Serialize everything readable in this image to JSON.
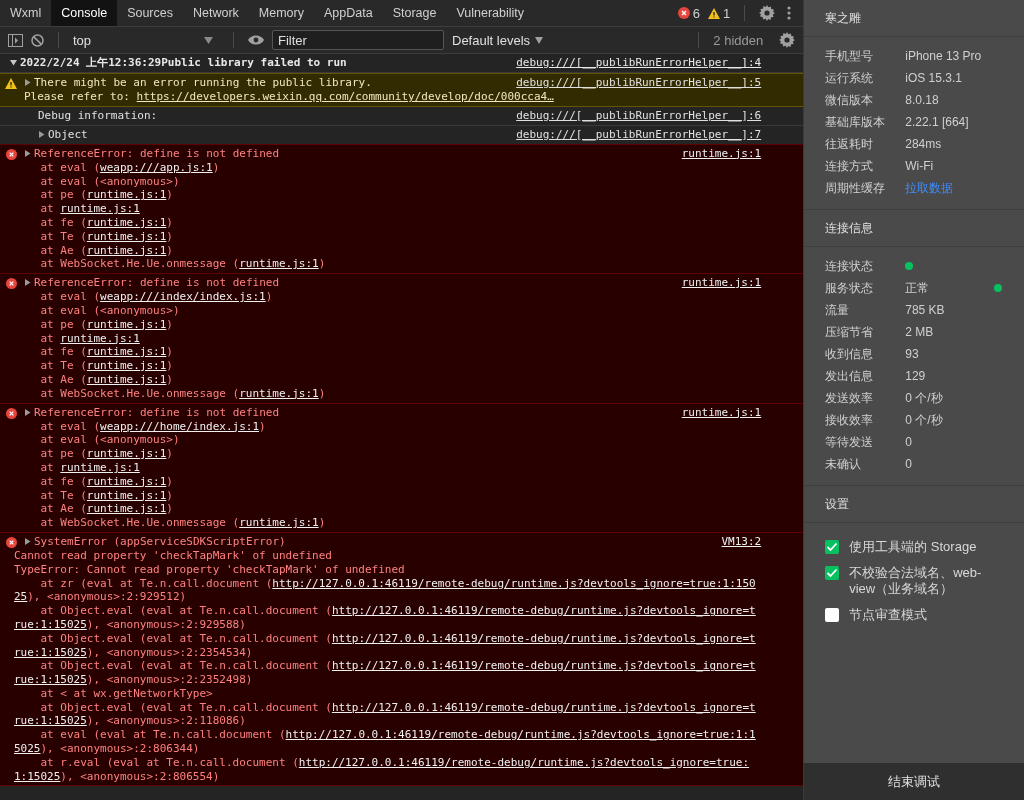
{
  "tabs": [
    {
      "label": "Wxml",
      "selected": false
    },
    {
      "label": "Console",
      "selected": true
    },
    {
      "label": "Sources",
      "selected": false
    },
    {
      "label": "Network",
      "selected": false
    },
    {
      "label": "Memory",
      "selected": false
    },
    {
      "label": "AppData",
      "selected": false
    },
    {
      "label": "Storage",
      "selected": false
    },
    {
      "label": "Vulnerability",
      "selected": false
    }
  ],
  "counts": {
    "errors": "6",
    "warnings": "1"
  },
  "toolbar": {
    "context": "top",
    "filter_placeholder": "Filter",
    "levels": "Default levels",
    "hidden": "2 hidden"
  },
  "console": [
    {
      "kind": "group",
      "expanded": true,
      "title": "2022/2/24 上午12:36:29Public library failed to run",
      "source": "debug:///[__publibRunErrorHelper__]:4"
    },
    {
      "kind": "warning",
      "expanded": false,
      "title": "There might be an error running the public library.",
      "source": "debug:///[__publibRunErrorHelper__]:5",
      "message": [
        {
          "text": "Please refer to: ",
          "link": "https://developers.weixin.qq.com/community/develop/doc/000cca4…"
        }
      ]
    },
    {
      "kind": "info",
      "title": "Debug information:",
      "source": "debug:///[__publibRunErrorHelper__]:6"
    },
    {
      "kind": "info",
      "expanded": false,
      "title": "Object",
      "source": "debug:///[__publibRunErrorHelper__]:7"
    },
    {
      "kind": "error",
      "expanded": false,
      "title": "ReferenceError: define is not defined",
      "source": "runtime.js:1",
      "stack": [
        {
          "text": "at eval (",
          "link": "weapp:///app.js:1",
          "after": ")"
        },
        {
          "text": "at eval (<anonymous>)"
        },
        {
          "text": "at pe (",
          "link": "runtime.js:1",
          "after": ")"
        },
        {
          "text": "at ",
          "link": "runtime.js:1"
        },
        {
          "text": "at fe (",
          "link": "runtime.js:1",
          "after": ")"
        },
        {
          "text": "at Te (",
          "link": "runtime.js:1",
          "after": ")"
        },
        {
          "text": "at Ae (",
          "link": "runtime.js:1",
          "after": ")"
        },
        {
          "text": "at WebSocket.He.Ue.onmessage (",
          "link": "runtime.js:1",
          "after": ")"
        }
      ]
    },
    {
      "kind": "error",
      "expanded": false,
      "title": "ReferenceError: define is not defined",
      "source": "runtime.js:1",
      "stack": [
        {
          "text": "at eval (",
          "link": "weapp:///index/index.js:1",
          "after": ")"
        },
        {
          "text": "at eval (<anonymous>)"
        },
        {
          "text": "at pe (",
          "link": "runtime.js:1",
          "after": ")"
        },
        {
          "text": "at ",
          "link": "runtime.js:1"
        },
        {
          "text": "at fe (",
          "link": "runtime.js:1",
          "after": ")"
        },
        {
          "text": "at Te (",
          "link": "runtime.js:1",
          "after": ")"
        },
        {
          "text": "at Ae (",
          "link": "runtime.js:1",
          "after": ")"
        },
        {
          "text": "at WebSocket.He.Ue.onmessage (",
          "link": "runtime.js:1",
          "after": ")"
        }
      ]
    },
    {
      "kind": "error",
      "expanded": false,
      "title": "ReferenceError: define is not defined",
      "source": "runtime.js:1",
      "stack": [
        {
          "text": "at eval (",
          "link": "weapp:///home/index.js:1",
          "after": ")"
        },
        {
          "text": "at eval (<anonymous>)"
        },
        {
          "text": "at pe (",
          "link": "runtime.js:1",
          "after": ")"
        },
        {
          "text": "at ",
          "link": "runtime.js:1"
        },
        {
          "text": "at fe (",
          "link": "runtime.js:1",
          "after": ")"
        },
        {
          "text": "at Te (",
          "link": "runtime.js:1",
          "after": ")"
        },
        {
          "text": "at Ae (",
          "link": "runtime.js:1",
          "after": ")"
        },
        {
          "text": "at WebSocket.He.Ue.onmessage (",
          "link": "runtime.js:1",
          "after": ")"
        }
      ]
    },
    {
      "kind": "error",
      "expanded": false,
      "title": "SystemError (appServiceSDKScriptError)",
      "source": "VM13:2",
      "message": [
        {
          "text": "Cannot read property 'checkTapMark' of undefined"
        },
        {
          "text": "TypeError: Cannot read property 'checkTapMark' of undefined"
        }
      ],
      "stack": [
        {
          "continued": false,
          "text": "at zr (eval at Te.n.call.document (",
          "link": "http://127.0.0.1:46119/remote-debug/runtime.js?devtools_ignore=true:1:150"
        },
        {
          "continued": true,
          "link": "25",
          "after": "), <anonymous>:2:929512)"
        },
        {
          "continued": false,
          "text": "at Object.eval (eval at Te.n.call.document (",
          "link": "http://127.0.0.1:46119/remote-debug/runtime.js?devtools_ignore=t"
        },
        {
          "continued": true,
          "link": "rue:1:15025",
          "after": "), <anonymous>:2:929588)"
        },
        {
          "continued": false,
          "text": "at Object.eval (eval at Te.n.call.document (",
          "link": "http://127.0.0.1:46119/remote-debug/runtime.js?devtools_ignore=t"
        },
        {
          "continued": true,
          "link": "rue:1:15025",
          "after": "), <anonymous>:2:2354534)"
        },
        {
          "continued": false,
          "text": "at Object.eval (eval at Te.n.call.document (",
          "link": "http://127.0.0.1:46119/remote-debug/runtime.js?devtools_ignore=t"
        },
        {
          "continued": true,
          "link": "rue:1:15025",
          "after": "), <anonymous>:2:2352498)"
        },
        {
          "continued": false,
          "text": "at < at wx.getNetworkType>"
        },
        {
          "continued": false,
          "text": "at Object.eval (eval at Te.n.call.document (",
          "link": "http://127.0.0.1:46119/remote-debug/runtime.js?devtools_ignore=t"
        },
        {
          "continued": true,
          "link": "rue:1:15025",
          "after": "), <anonymous>:2:118086)"
        },
        {
          "continued": false,
          "text": "at eval (eval at Te.n.call.document (",
          "link": "http://127.0.0.1:46119/remote-debug/runtime.js?devtools_ignore=true:1:1"
        },
        {
          "continued": true,
          "link": "5025",
          "after": "), <anonymous>:2:806344)"
        },
        {
          "continued": false,
          "text": "at r.eval (eval at Te.n.call.document (",
          "link": "http://127.0.0.1:46119/remote-debug/runtime.js?devtools_ignore=true:"
        },
        {
          "continued": true,
          "link": "1:15025",
          "after": "), <anonymous>:2:806554)"
        }
      ]
    }
  ],
  "sidebar": {
    "title": "寒之雕",
    "device": [
      {
        "label": "手机型号",
        "value": "iPhone 13 Pro"
      },
      {
        "label": "运行系统",
        "value": "iOS 15.3.1"
      },
      {
        "label": "微信版本",
        "value": "8.0.18"
      },
      {
        "label": "基础库版本",
        "value": "2.22.1 [664]"
      },
      {
        "label": "往返耗时",
        "value": "284ms"
      },
      {
        "label": "连接方式",
        "value": "Wi-Fi"
      },
      {
        "label": "周期性缓存",
        "value": "拉取数据",
        "kind": "link"
      }
    ],
    "connection_title": "连接信息",
    "connection": [
      {
        "label": "连接状态",
        "color": "#07c160"
      },
      {
        "label": "服务状态",
        "value": "正常",
        "color": "#07c160"
      },
      {
        "label": "流量",
        "value": "785 KB"
      },
      {
        "label": "压缩节省",
        "value": "2 MB"
      },
      {
        "label": "收到信息",
        "value": "93"
      },
      {
        "label": "发出信息",
        "value": "129"
      },
      {
        "label": "发送效率",
        "value": "0 个/秒"
      },
      {
        "label": "接收效率",
        "value": "0 个/秒"
      },
      {
        "label": "等待发送",
        "value": "0"
      },
      {
        "label": "未确认",
        "value": "0"
      }
    ],
    "settings_title": "设置",
    "settings": [
      {
        "label": "使用工具端的 Storage",
        "checked": true
      },
      {
        "label": "不校验合法域名、web-view（业务域名）",
        "checked": true
      },
      {
        "label": "节点审查模式",
        "checked": false
      }
    ],
    "end_button": "结束调试"
  }
}
